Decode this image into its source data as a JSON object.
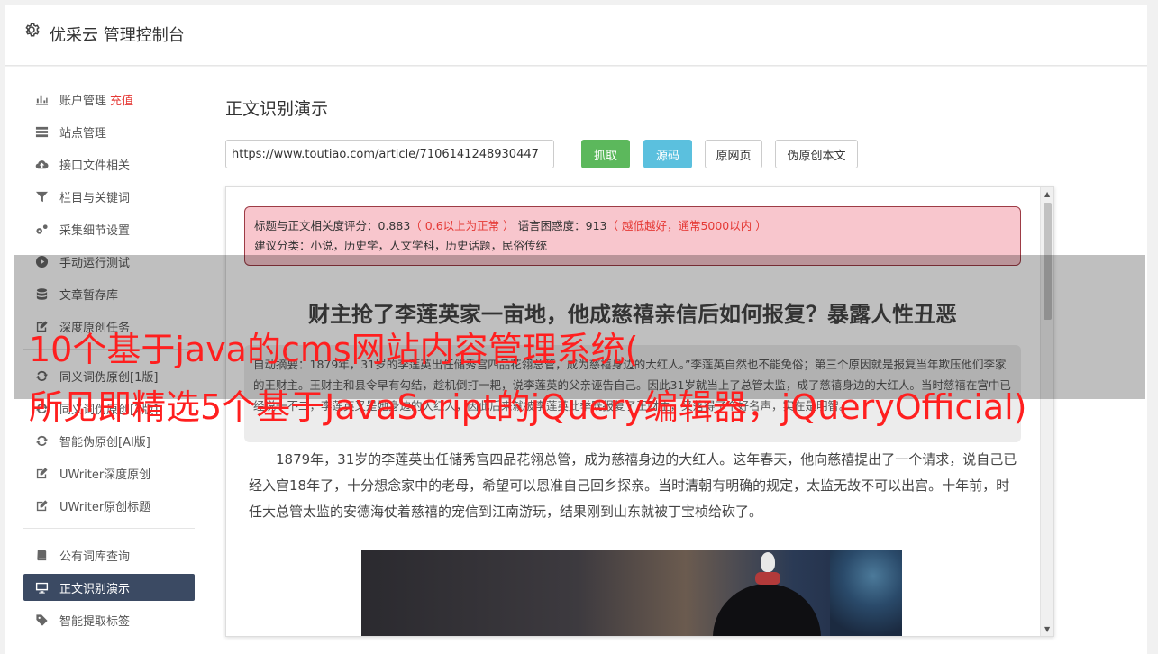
{
  "header": {
    "title": "优采云 管理控制台"
  },
  "sidebar": {
    "items": [
      {
        "label": "账户管理",
        "extra": "充值",
        "icon": "bar-chart-icon"
      },
      {
        "label": "站点管理",
        "icon": "server-icon"
      },
      {
        "label": "接口文件相关",
        "icon": "cloud-upload-icon"
      },
      {
        "label": "栏目与关键词",
        "icon": "filter-icon"
      },
      {
        "label": "采集细节设置",
        "icon": "gears-icon"
      },
      {
        "label": "手动运行测试",
        "icon": "play-circle-icon"
      },
      {
        "label": "文章暂存库",
        "icon": "database-icon"
      },
      {
        "label": "深度原创任务",
        "icon": "edit-icon"
      },
      {
        "label": "同义词伪原创[1版]",
        "icon": "refresh-icon"
      },
      {
        "label": "同义词伪原创[2版]",
        "icon": "refresh-icon"
      },
      {
        "label": "智能伪原创[AI版]",
        "icon": "refresh-icon"
      },
      {
        "label": "UWriter深度原创",
        "icon": "edit-icon"
      },
      {
        "label": "UWriter原创标题",
        "icon": "edit-icon"
      },
      {
        "label": "公有词库查询",
        "icon": "book-icon"
      },
      {
        "label": "正文识别演示",
        "icon": "monitor-icon",
        "active": true
      },
      {
        "label": "智能提取标签",
        "icon": "tag-icon"
      }
    ]
  },
  "main": {
    "title": "正文识别演示",
    "url_value": "https://www.toutiao.com/article/7106141248930447",
    "buttons": {
      "fetch": "抓取",
      "source": "源码",
      "original": "原网页",
      "pseudo": "伪原创本文"
    }
  },
  "result": {
    "score_label": "标题与正文相关度评分：0.883",
    "score_note": "（ 0.6以上为正常 ）",
    "perplexity_label": "语言困惑度：913",
    "perplexity_note": "（ 越低越好，通常5000以内 ）",
    "categories": "建议分类：小说，历史学，人文学科，历史话题，民俗传统",
    "article_title": "财主抢了李莲英家一亩地，他成慈禧亲信后如何报复？暴露人性丑恶",
    "summary": "自动摘要：1879年，31岁的李莲英出任储秀宫四品花翎总管，成为慈禧身边的大红人。”李莲英自然也不能免俗；第三个原因就是报复当年欺压他们李家的王财主。王财主和县令早有勾结，趁机倒打一耙，说李莲英的父亲诬告自己。因此31岁就当上了总管太监，成了慈禧身边的大红人。当时慈禧在宫中已经说一不二，李莲英又是她身边的大红人，因此后来就被李莲英此举既报复了王财主，又落得了个好名声，实在是明智。",
    "body": "1879年，31岁的李莲英出任储秀宫四品花翎总管，成为慈禧身边的大红人。这年春天，他向慈禧提出了一个请求，说自己已经入宫18年了，十分想念家中的老母，希望可以恩准自己回乡探亲。当时清朝有明确的规定，太监无故不可以出宫。十年前，时任大总管太监的安德海仗着慈禧的宠信到江南游玩，结果刚到山东就被丁宝桢给砍了。"
  },
  "overlay": {
    "line1": "10个基于java的cms网站内容管理系统(",
    "line2": "所见即精选5个基于JavaScript的jQuery编辑器，jQueryOfficial)"
  }
}
